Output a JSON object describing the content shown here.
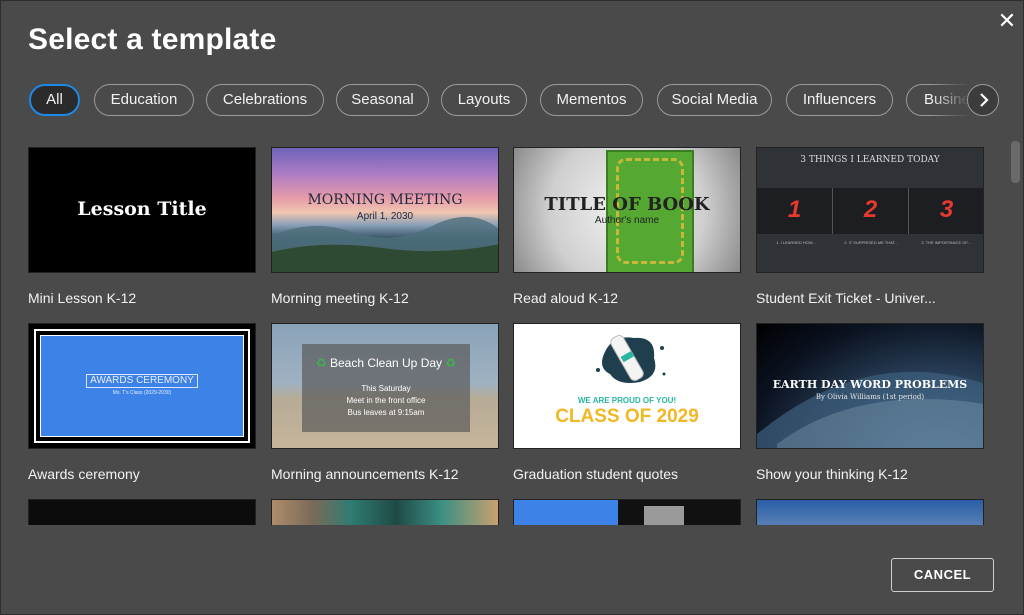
{
  "dialog": {
    "title": "Select a template",
    "close_icon": "✕",
    "cancel_label": "CANCEL"
  },
  "filters": [
    {
      "label": "All",
      "active": true
    },
    {
      "label": "Education"
    },
    {
      "label": "Celebrations"
    },
    {
      "label": "Seasonal"
    },
    {
      "label": "Layouts"
    },
    {
      "label": "Mementos"
    },
    {
      "label": "Social Media"
    },
    {
      "label": "Influencers"
    },
    {
      "label": "Business"
    }
  ],
  "templates": [
    {
      "name": "Mini Lesson K-12",
      "thumb_text": "Lesson Title"
    },
    {
      "name": "Morning meeting K-12",
      "thumb_title": "MORNING MEETING",
      "thumb_sub": "April 1, 2030"
    },
    {
      "name": "Read aloud K-12",
      "thumb_title": "TITLE OF BOOK",
      "thumb_sub": "Author's name"
    },
    {
      "name": "Student Exit Ticket - Univer...",
      "thumb_title": "3 THINGS I LEARNED TODAY",
      "nums": [
        "1",
        "2",
        "3"
      ],
      "foot": [
        "1. I LEARNED HOW...",
        "2. IT SURPRISED ME THAT...",
        "3. THE IMPORTANCE OF..."
      ]
    },
    {
      "name": "Awards ceremony",
      "thumb_title": "AWARDS CEREMONY",
      "thumb_sub": "Ms. T's Class (2029-2030)"
    },
    {
      "name": "Morning announcements K-12",
      "thumb_title": "Beach Clean Up Day",
      "lines": [
        "This Saturday",
        "Meet in the front office",
        "Bus leaves at 9:15am"
      ]
    },
    {
      "name": "Graduation student quotes",
      "thumb_title": "WE ARE PROUD OF YOU!",
      "thumb_sub": "CLASS OF 2029"
    },
    {
      "name": "Show your thinking K-12",
      "thumb_title": "EARTH DAY WORD PROBLEMS",
      "thumb_sub": "By Olivia Williams (1st period)"
    }
  ],
  "colors": {
    "background": "#4a4a4a",
    "active_chip_border": "#1e88e5",
    "graduation_accent": "#f2b824",
    "exit_ticket_numbers": "#e8392e"
  }
}
